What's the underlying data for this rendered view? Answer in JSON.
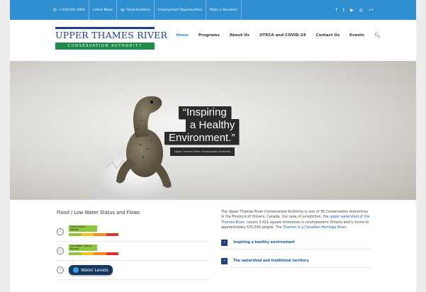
{
  "topbar": {
    "phone": "1-519-451-2800",
    "items": [
      "Latest News",
      "Flood Bulletins",
      "Employment Opportunities",
      "Make a Donation"
    ],
    "social_icons": [
      "facebook-icon",
      "twitter-icon",
      "youtube-icon",
      "instagram-icon",
      "flickr-icon"
    ]
  },
  "logo": {
    "line1": "UPPER THAMES RIVER",
    "line2": "CONSERVATION AUTHORITY"
  },
  "nav": {
    "items": [
      "Home",
      "Programs",
      "About Us",
      "UTRCA and COVID-19",
      "Contact Us",
      "Events"
    ],
    "active": "Home"
  },
  "hero": {
    "quote_lines": [
      "“Inspiring",
      "a Healthy",
      "Environment.”"
    ],
    "caption": "Upper Thames River Conservation Authority"
  },
  "flood": {
    "title": "Flood / Low Water Status and Flows",
    "rows": [
      {
        "label1": "Flood Status:",
        "label2": "Normal"
      },
      {
        "label1": "Low Water Status:",
        "label2": "Normal"
      }
    ],
    "button_label": "Water Levels"
  },
  "about": {
    "text_plain": "The Upper Thames River Conservation Authority is one of 36 Conservation Authorities in the Province of Ontario, Canada. Our area of jurisdiction, the",
    "text_link": "upper watershed of the Thames River",
    "text_plain2": ", covers 3,421 square kilometres in southwestern Ontario and is home to approximately 535,500 people.",
    "text_link2": "The Thames is a Canadian Heritage River."
  },
  "links": [
    "Inspiring a healthy environment",
    "The watershed and traditional territory"
  ],
  "colors": {
    "topbar": "#2f8fd0",
    "brand_blue": "#1d3f8f",
    "brand_green": "#1f8a4a",
    "button_navy": "#16385e"
  }
}
